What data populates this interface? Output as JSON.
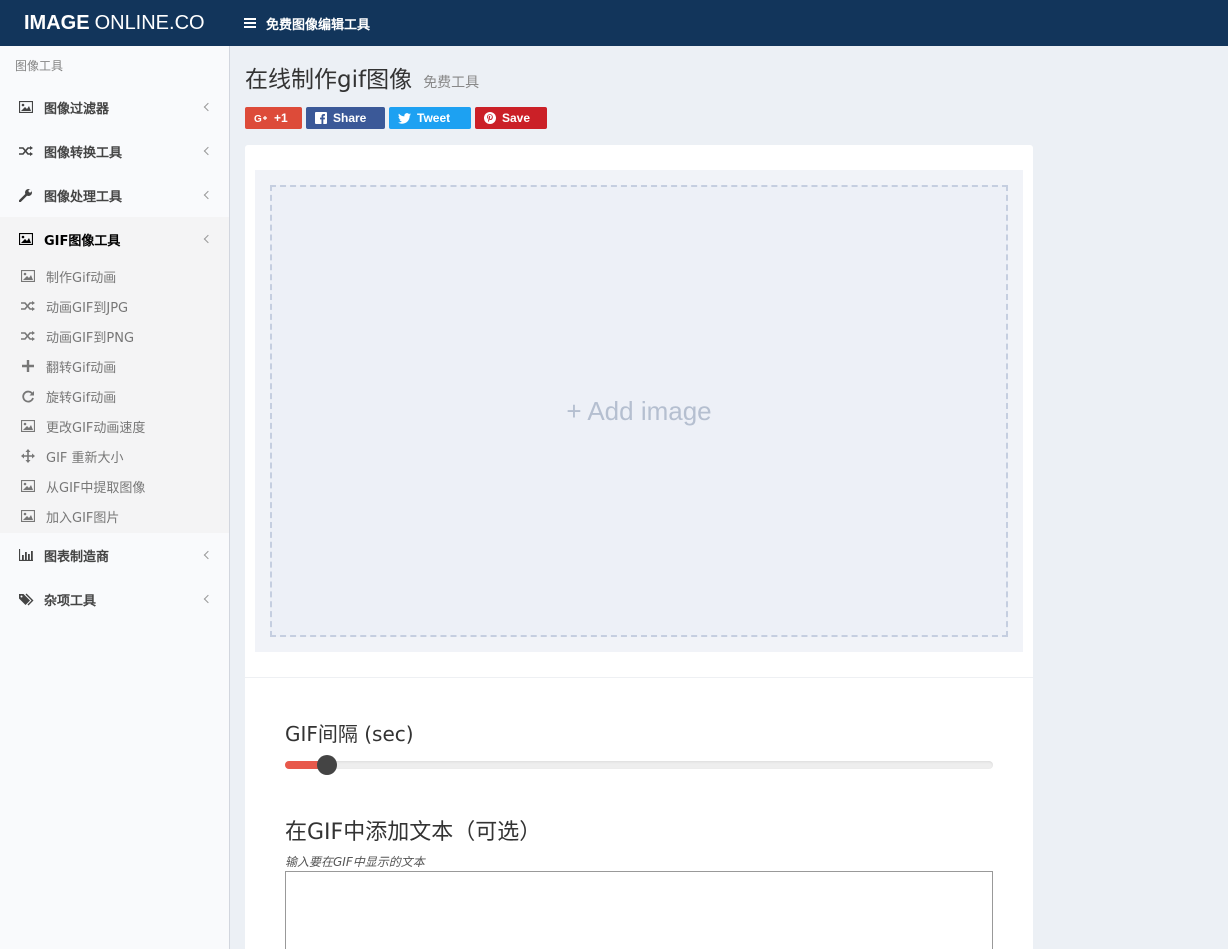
{
  "header": {
    "logo_bold": "IMAGE",
    "logo_rest": "ONLINE.CO",
    "nav_label": "免费图像编辑工具"
  },
  "sidebar": {
    "header": "图像工具",
    "menu": [
      {
        "label": "图像过滤器",
        "icon": "image-icon"
      },
      {
        "label": "图像转换工具",
        "icon": "shuffle-icon"
      },
      {
        "label": "图像处理工具",
        "icon": "wrench-icon"
      },
      {
        "label": "GIF图像工具",
        "icon": "image-icon",
        "active": true
      },
      {
        "label": "图表制造商",
        "icon": "bar-chart-icon"
      },
      {
        "label": "杂项工具",
        "icon": "tags-icon"
      }
    ],
    "gif_submenu": [
      {
        "label": "制作Gif动画",
        "icon": "image-icon"
      },
      {
        "label": "动画GIF到JPG",
        "icon": "shuffle-icon"
      },
      {
        "label": "动画GIF到PNG",
        "icon": "shuffle-icon"
      },
      {
        "label": "翻转Gif动画",
        "icon": "plus-icon"
      },
      {
        "label": "旋转Gif动画",
        "icon": "rotate-icon"
      },
      {
        "label": "更改GIF动画速度",
        "icon": "image-icon"
      },
      {
        "label": "GIF 重新大小",
        "icon": "arrows-icon"
      },
      {
        "label": "从GIF中提取图像",
        "icon": "image-icon"
      },
      {
        "label": "加入GIF图片",
        "icon": "image-icon"
      }
    ]
  },
  "main": {
    "title": "在线制作gif图像",
    "subtitle": "免费工具",
    "share": {
      "gplus": "+1",
      "facebook": "Share",
      "twitter": "Tweet",
      "pinterest": "Save"
    },
    "dropzone_label": "+ Add image",
    "interval_label": "GIF间隔 (sec)",
    "interval_slider_fraction": 0.06,
    "text_section_title": "在GIF中添加文本（可选）",
    "text_hint": "输入要在GIF中显示的文本",
    "text_value": ""
  },
  "colors": {
    "header_bg": "#12355b",
    "accent_red": "#e8594b",
    "gplus": "#dd4b39",
    "facebook": "#3b5998",
    "twitter": "#1da1f2",
    "pinterest": "#cb2027"
  }
}
